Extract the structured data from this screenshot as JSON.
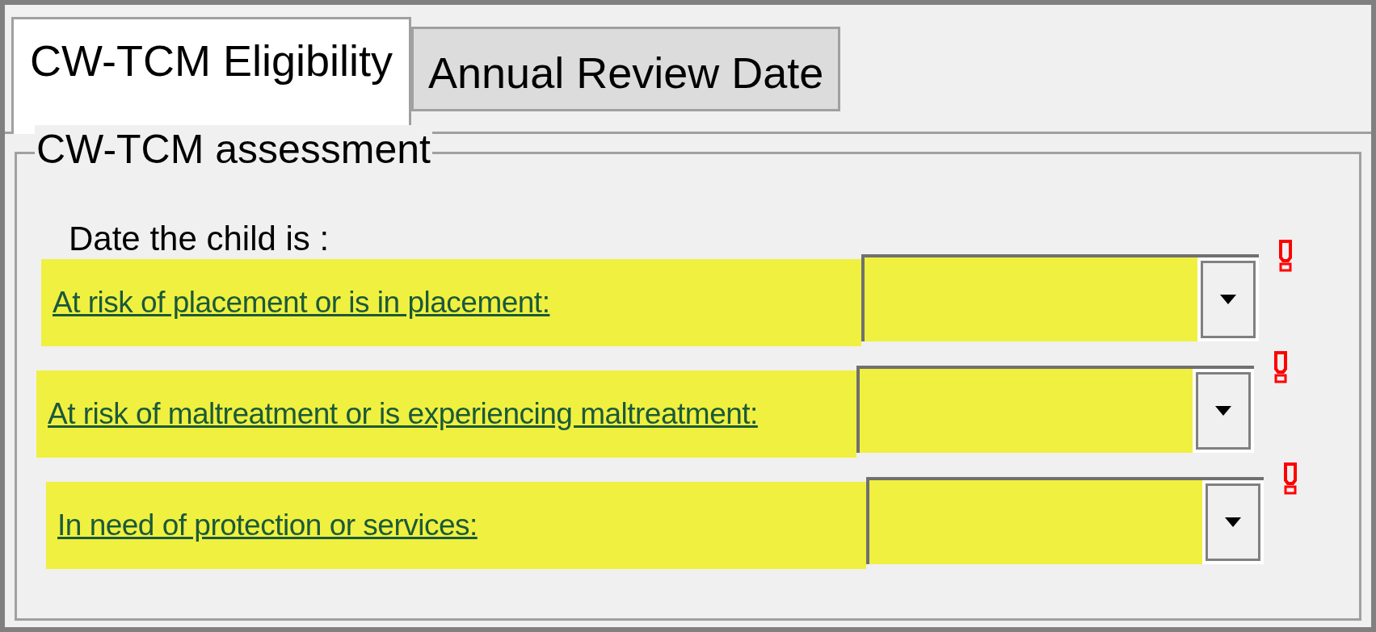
{
  "tabs": [
    {
      "label": "CW-TCM Eligibility",
      "selected": true
    },
    {
      "label": "Annual Review Date",
      "selected": false
    }
  ],
  "group": {
    "legend": "CW-TCM assessment",
    "prompt": "Date the child is :",
    "rows": [
      {
        "label": "At risk of placement or is in placement:",
        "required": true
      },
      {
        "label": "At risk of maltreatment or is experiencing maltreatment:",
        "required": true
      },
      {
        "label": "In need of protection or services:",
        "required": true
      }
    ]
  }
}
